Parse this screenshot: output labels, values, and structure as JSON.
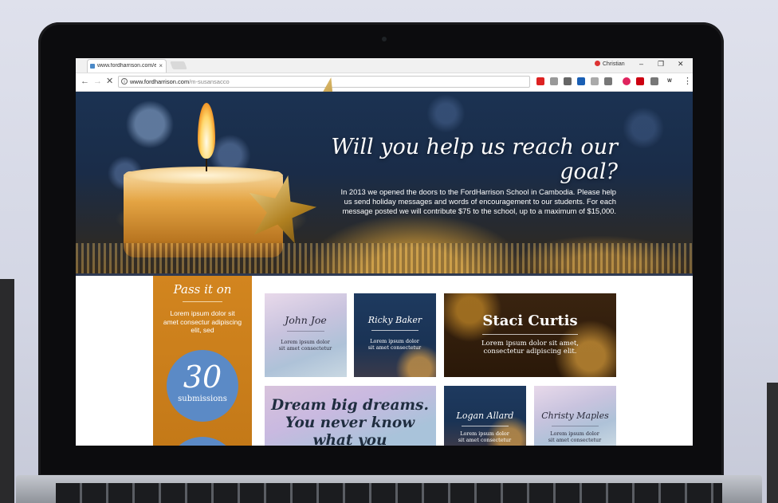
{
  "browser": {
    "tab_title": "www.fordharrison.com/e",
    "profile_name": "Christian",
    "url_domain": "www.fordharrison.com",
    "url_path": "/m-susansacco",
    "extensions": [
      "ABP",
      "E",
      "S",
      "V",
      "A",
      "R",
      "P",
      "M",
      "C",
      "W"
    ]
  },
  "hero": {
    "title": "Will you help us reach our goal?",
    "body": "In 2013 we opened the doors to the FordHarrison School in Cambodia. Please help us send holiday messages and words of encouragement to our students. For each message posted we will contribute $75 to the school, up to a maximum of $15,000."
  },
  "sidebar": {
    "title": "Pass it on",
    "text": "Lorem ipsum dolor sit amet consectur adipiscing elit, sed",
    "count": "30",
    "count_label": "submissions"
  },
  "cards": [
    {
      "name": "John Joe",
      "message": "Lorem ipsum dolor sit amet consectetur"
    },
    {
      "name": "Ricky Baker",
      "message": "Lorem ipsum dolor sit amet consectetur"
    },
    {
      "name": "Staci Curtis",
      "message": "Lorem ipsum dolor sit amet, consectetur adipiscing elit."
    },
    {
      "name": "Logan Allard",
      "message": "Lorem ipsum dolor sit amet consectetur"
    },
    {
      "name": "Christy Maples",
      "message": "Lorem ipsum dolor sit amet consectetur"
    }
  ],
  "quote_card": {
    "text": "Dream big dreams. You never know what you"
  },
  "colors": {
    "sidebar_orange": "#d2851f",
    "counter_blue": "#5b8ac6",
    "hero_navy": "#1a2c48"
  }
}
